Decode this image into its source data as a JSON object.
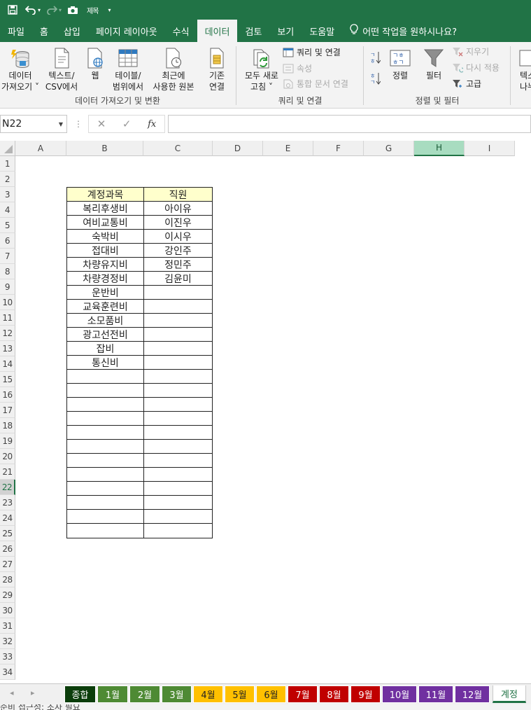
{
  "titlebar": {
    "app_text": "제목"
  },
  "tabs": [
    {
      "label": "파일"
    },
    {
      "label": "홈"
    },
    {
      "label": "삽입"
    },
    {
      "label": "페이지 레이아웃"
    },
    {
      "label": "수식"
    },
    {
      "label": "데이터",
      "active": true
    },
    {
      "label": "검토"
    },
    {
      "label": "보기"
    },
    {
      "label": "도움말"
    },
    {
      "label": "어떤 작업을 원하시나요?"
    }
  ],
  "ribbon": {
    "get_data": {
      "l1": "데이터",
      "l2": "가져오기 ˅"
    },
    "from_csv": {
      "l1": "텍스트/",
      "l2": "CSV에서"
    },
    "from_web": {
      "l1": "웹"
    },
    "from_table": {
      "l1": "테이블/",
      "l2": "범위에서"
    },
    "recent": {
      "l1": "최근에",
      "l2": "사용한 원본"
    },
    "existing": {
      "l1": "기존",
      "l2": "연결"
    },
    "group1_label": "데이터 가져오기 및 변환",
    "refresh_all": {
      "l1": "모두 새로",
      "l2": "고침 ˅"
    },
    "queries": "쿼리 및 연결",
    "properties": "속성",
    "edit_links": "통합 문서 연결",
    "group2_label": "쿼리 및 연결",
    "sort": "정렬",
    "filter": "필터",
    "clear": "지우기",
    "reapply": "다시 적용",
    "advanced": "고급",
    "group3_label": "정렬 및 필터",
    "text_to_col": {
      "l1": "텍스",
      "l2": "나누"
    }
  },
  "formula_bar": {
    "name_box": "N22",
    "fx": "fx",
    "value": ""
  },
  "columns": [
    {
      "label": "A"
    },
    {
      "label": "B"
    },
    {
      "label": "C"
    },
    {
      "label": "D"
    },
    {
      "label": "E"
    },
    {
      "label": "F"
    },
    {
      "label": "G"
    },
    {
      "label": "H",
      "selected": true
    },
    {
      "label": "I"
    }
  ],
  "rows": [
    "1",
    "2",
    "3",
    "4",
    "5",
    "6",
    "7",
    "8",
    "9",
    "10",
    "11",
    "12",
    "13",
    "14",
    "15",
    "16",
    "17",
    "18",
    "19",
    "20",
    "21",
    "22",
    "23",
    "24",
    "25",
    "26",
    "27",
    "28",
    "29",
    "30",
    "31",
    "32",
    "33",
    "34"
  ],
  "selected_row": "22",
  "table": {
    "headers": [
      "계정과목",
      "직원"
    ],
    "rows": [
      [
        "복리후생비",
        "아이유"
      ],
      [
        "여비교통비",
        "이진우"
      ],
      [
        "숙박비",
        "이시우"
      ],
      [
        "접대비",
        "강인주"
      ],
      [
        "차량유지비",
        "정민주"
      ],
      [
        "차량경정비",
        "김윤미"
      ],
      [
        "운반비",
        ""
      ],
      [
        "교육훈련비",
        ""
      ],
      [
        "소모품비",
        ""
      ],
      [
        "광고선전비",
        ""
      ],
      [
        "잡비",
        ""
      ],
      [
        "통신비",
        ""
      ],
      [
        "",
        ""
      ],
      [
        "",
        ""
      ],
      [
        "",
        ""
      ],
      [
        "",
        ""
      ],
      [
        "",
        ""
      ],
      [
        "",
        ""
      ],
      [
        "",
        ""
      ],
      [
        "",
        ""
      ],
      [
        "",
        ""
      ],
      [
        "",
        ""
      ],
      [
        "",
        ""
      ],
      [
        "",
        ""
      ]
    ]
  },
  "sheet_tabs": [
    {
      "label": "종합",
      "bg": "#0b3d0b",
      "fg": "#ffffff"
    },
    {
      "label": "1월",
      "bg": "#4e8a34",
      "fg": "#ffffff"
    },
    {
      "label": "2월",
      "bg": "#4e8a34",
      "fg": "#ffffff"
    },
    {
      "label": "3월",
      "bg": "#4e8a34",
      "fg": "#ffffff"
    },
    {
      "label": "4월",
      "bg": "#ffc000",
      "fg": "#222222"
    },
    {
      "label": "5월",
      "bg": "#ffc000",
      "fg": "#222222"
    },
    {
      "label": "6월",
      "bg": "#ffc000",
      "fg": "#222222"
    },
    {
      "label": "7월",
      "bg": "#c00000",
      "fg": "#ffffff"
    },
    {
      "label": "8월",
      "bg": "#c00000",
      "fg": "#ffffff"
    },
    {
      "label": "9월",
      "bg": "#c00000",
      "fg": "#ffffff"
    },
    {
      "label": "10월",
      "bg": "#7030a0",
      "fg": "#ffffff"
    },
    {
      "label": "11월",
      "bg": "#7030a0",
      "fg": "#ffffff"
    },
    {
      "label": "12월",
      "bg": "#7030a0",
      "fg": "#ffffff"
    },
    {
      "label": "계정",
      "bg": "#ffffff",
      "fg": "#217346",
      "active": true
    }
  ],
  "status": {
    "text": "준비  접근성: 조사 필요"
  },
  "colors": {
    "accent": "#217346",
    "header_fill": "#ffffcc"
  }
}
